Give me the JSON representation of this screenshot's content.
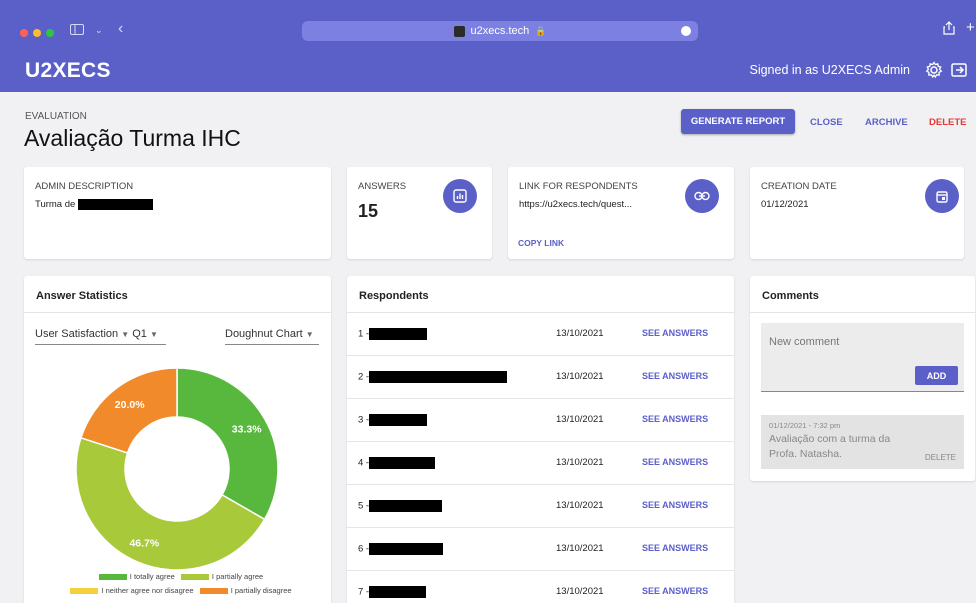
{
  "browser": {
    "url": "u2xecs.tech",
    "lock_glyph": "🔒"
  },
  "header": {
    "brand": "U2XECS",
    "signed_in": "Signed in as U2XECS Admin"
  },
  "page": {
    "tag": "EVALUATION",
    "title": "Avaliação Turma IHC",
    "actions": {
      "generate": "GENERATE REPORT",
      "close": "CLOSE",
      "archive": "ARCHIVE",
      "delete": "DELETE"
    }
  },
  "cards": {
    "admin": {
      "label": "ADMIN DESCRIPTION",
      "value": "Turma de"
    },
    "answers": {
      "label": "ANSWERS",
      "value": "15"
    },
    "link": {
      "label": "LINK FOR RESPONDENTS",
      "value": "https://u2xecs.tech/quest...",
      "copy": "COPY LINK"
    },
    "creation": {
      "label": "CREATION DATE",
      "value": "01/12/2021"
    }
  },
  "stats": {
    "title": "Answer Statistics",
    "question_select": "User Satisfaction",
    "q_select": "Q1",
    "chart_select": "Doughnut Chart",
    "colors": {
      "totally_agree": "#58b83e",
      "partially_agree": "#a8c93a",
      "neither": "#f4d03f",
      "partially_disagree": "#f08a2b"
    }
  },
  "chart_data": {
    "type": "pie",
    "variant": "doughnut",
    "labels": [
      "I totally agree",
      "I partially agree",
      "I neither agree nor disagree",
      "I partially disagree"
    ],
    "values": [
      33.3,
      46.7,
      0,
      20.0
    ],
    "data_labels": [
      "33.3%",
      "46.7%",
      "",
      "20.0%"
    ]
  },
  "respondents": {
    "title": "Respondents",
    "see_label": "SEE ANSWERS",
    "rows": [
      {
        "num": "1 -",
        "date": "13/10/2021",
        "redact": 58
      },
      {
        "num": "2 -",
        "date": "13/10/2021",
        "redact": 138
      },
      {
        "num": "3 -",
        "date": "13/10/2021",
        "redact": 58
      },
      {
        "num": "4 -",
        "date": "13/10/2021",
        "redact": 66
      },
      {
        "num": "5 -",
        "date": "13/10/2021",
        "redact": 73
      },
      {
        "num": "6 -",
        "date": "13/10/2021",
        "redact": 74
      },
      {
        "num": "7 -",
        "date": "13/10/2021",
        "redact": 57
      }
    ]
  },
  "comments": {
    "title": "Comments",
    "placeholder": "New comment",
    "add": "ADD",
    "items": [
      {
        "meta": "01/12/2021 - 7:32 pm",
        "text": "Avaliação com a turma da Profa. Natasha.",
        "delete": "DELETE"
      }
    ]
  }
}
